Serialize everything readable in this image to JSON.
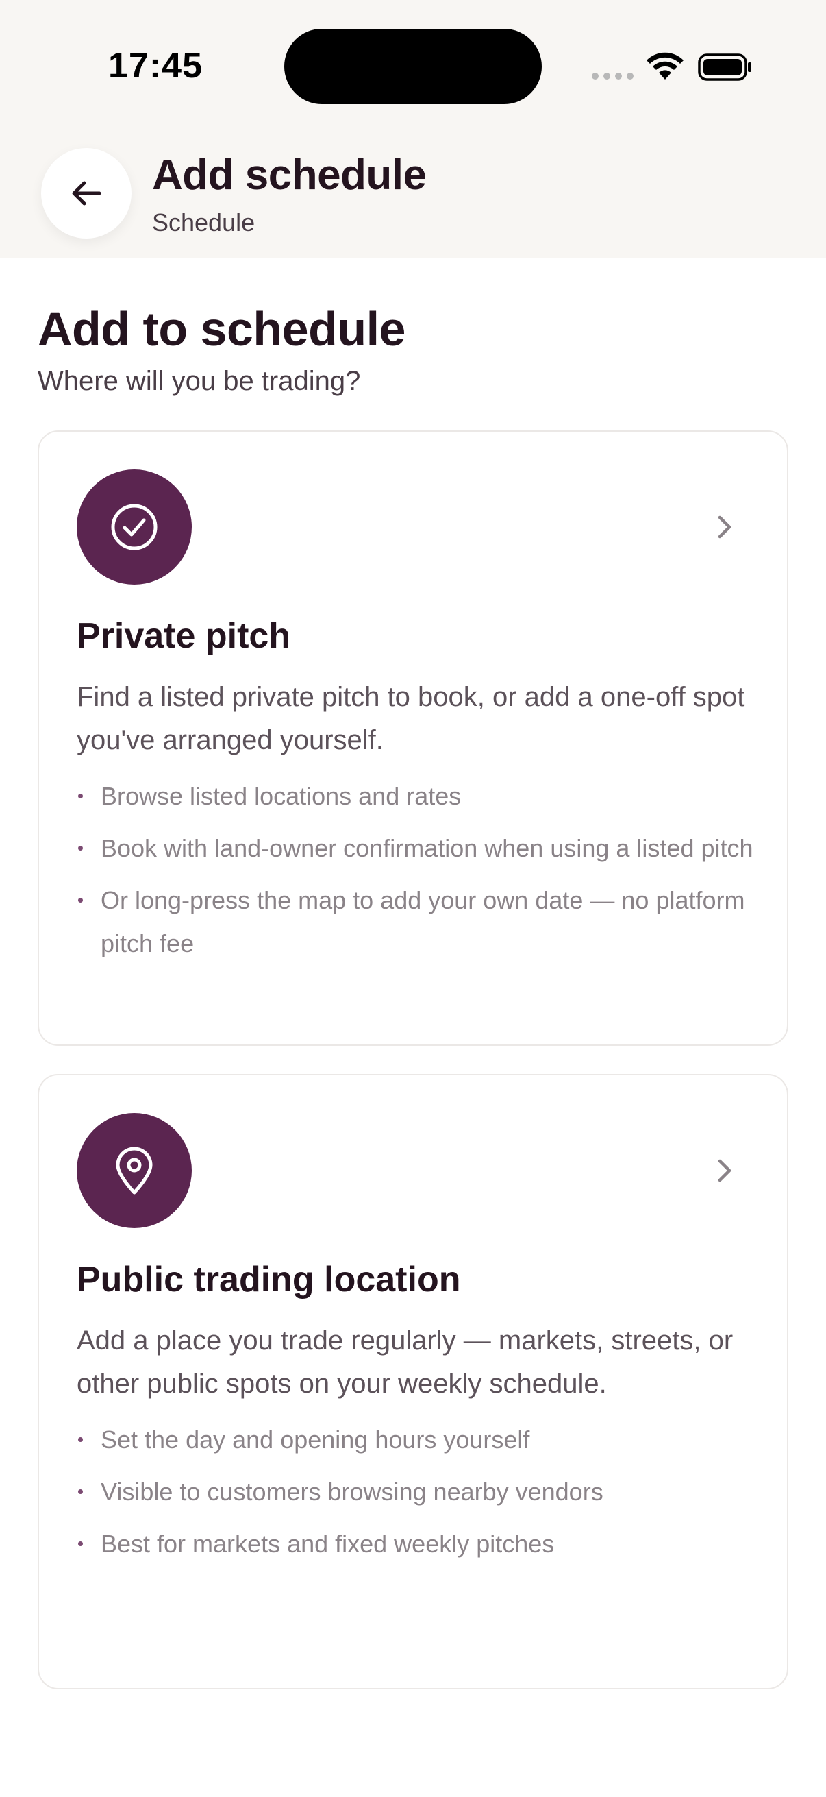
{
  "status_bar": {
    "time": "17:45"
  },
  "header": {
    "title": "Add schedule",
    "subtitle": "Schedule",
    "back_icon": "arrow-left-icon"
  },
  "page": {
    "heading": "Add to schedule",
    "subheading": "Where will you be trading?"
  },
  "options": [
    {
      "icon": "check-circle-icon",
      "title": "Private pitch",
      "description": "Find a listed private pitch to book, or add a one-off spot you've arranged yourself.",
      "bullets": [
        "Browse listed locations and rates",
        "Book with land-owner confirmation when using a listed pitch",
        "Or long-press the map to add your own date — no platform pitch fee"
      ]
    },
    {
      "icon": "map-pin-icon",
      "title": "Public trading location",
      "description": "Add a place you trade regularly — markets, streets, or other public spots on your weekly schedule.",
      "bullets": [
        "Set the day and opening hours yourself",
        "Visible to customers browsing nearby vendors",
        "Best for markets and fixed weekly pitches"
      ]
    }
  ],
  "colors": {
    "accent": "#5b2550",
    "header_background": "#f8f6f3",
    "text_primary": "#24141f",
    "text_secondary": "#5c525a",
    "text_muted": "#8a8388",
    "card_border": "#ebe8e6"
  }
}
